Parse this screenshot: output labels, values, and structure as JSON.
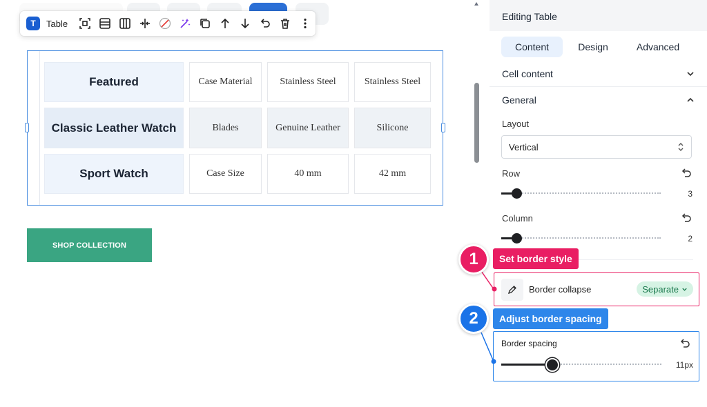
{
  "toolbar": {
    "badge": "T",
    "label": "Table",
    "buttons": [
      "select-parent",
      "row",
      "column",
      "split",
      "clear-format",
      "magic",
      "duplicate",
      "move-up",
      "move-down",
      "undo",
      "delete",
      "more"
    ]
  },
  "table": {
    "rows": [
      {
        "head": "Featured",
        "cells": [
          "Case Material",
          "Stainless Steel",
          "Stainless Steel"
        ]
      },
      {
        "head": "Classic Leather Watch",
        "cells": [
          "Blades",
          "Genuine Leather",
          "Silicone"
        ]
      },
      {
        "head": "Sport Watch",
        "cells": [
          "Case Size",
          "40 mm",
          "42 mm"
        ]
      }
    ]
  },
  "shop_button": {
    "label": "SHOP COLLECTION"
  },
  "panel": {
    "title": "Editing Table",
    "tabs": {
      "content": "Content",
      "design": "Design",
      "advanced": "Advanced"
    },
    "cell_content": "Cell content",
    "general": "General",
    "layout_label": "Layout",
    "layout_value": "Vertical",
    "row_label": "Row",
    "row_value": "3",
    "column_label": "Column",
    "column_value": "2",
    "border_collapse_label": "Border collapse",
    "border_collapse_value": "Separate",
    "border_spacing_label": "Border spacing",
    "border_spacing_value": "11px"
  },
  "annotations": {
    "one": {
      "num": "1",
      "text": "Set border style"
    },
    "two": {
      "num": "2",
      "text": "Adjust border spacing"
    }
  },
  "colors": {
    "accent": "#1a5fd1",
    "pink": "#e91e63",
    "blue": "#2e86ea",
    "shop": "#3aa582",
    "pill_bg": "#d6f3e4",
    "pill_text": "#1c7a4e"
  }
}
